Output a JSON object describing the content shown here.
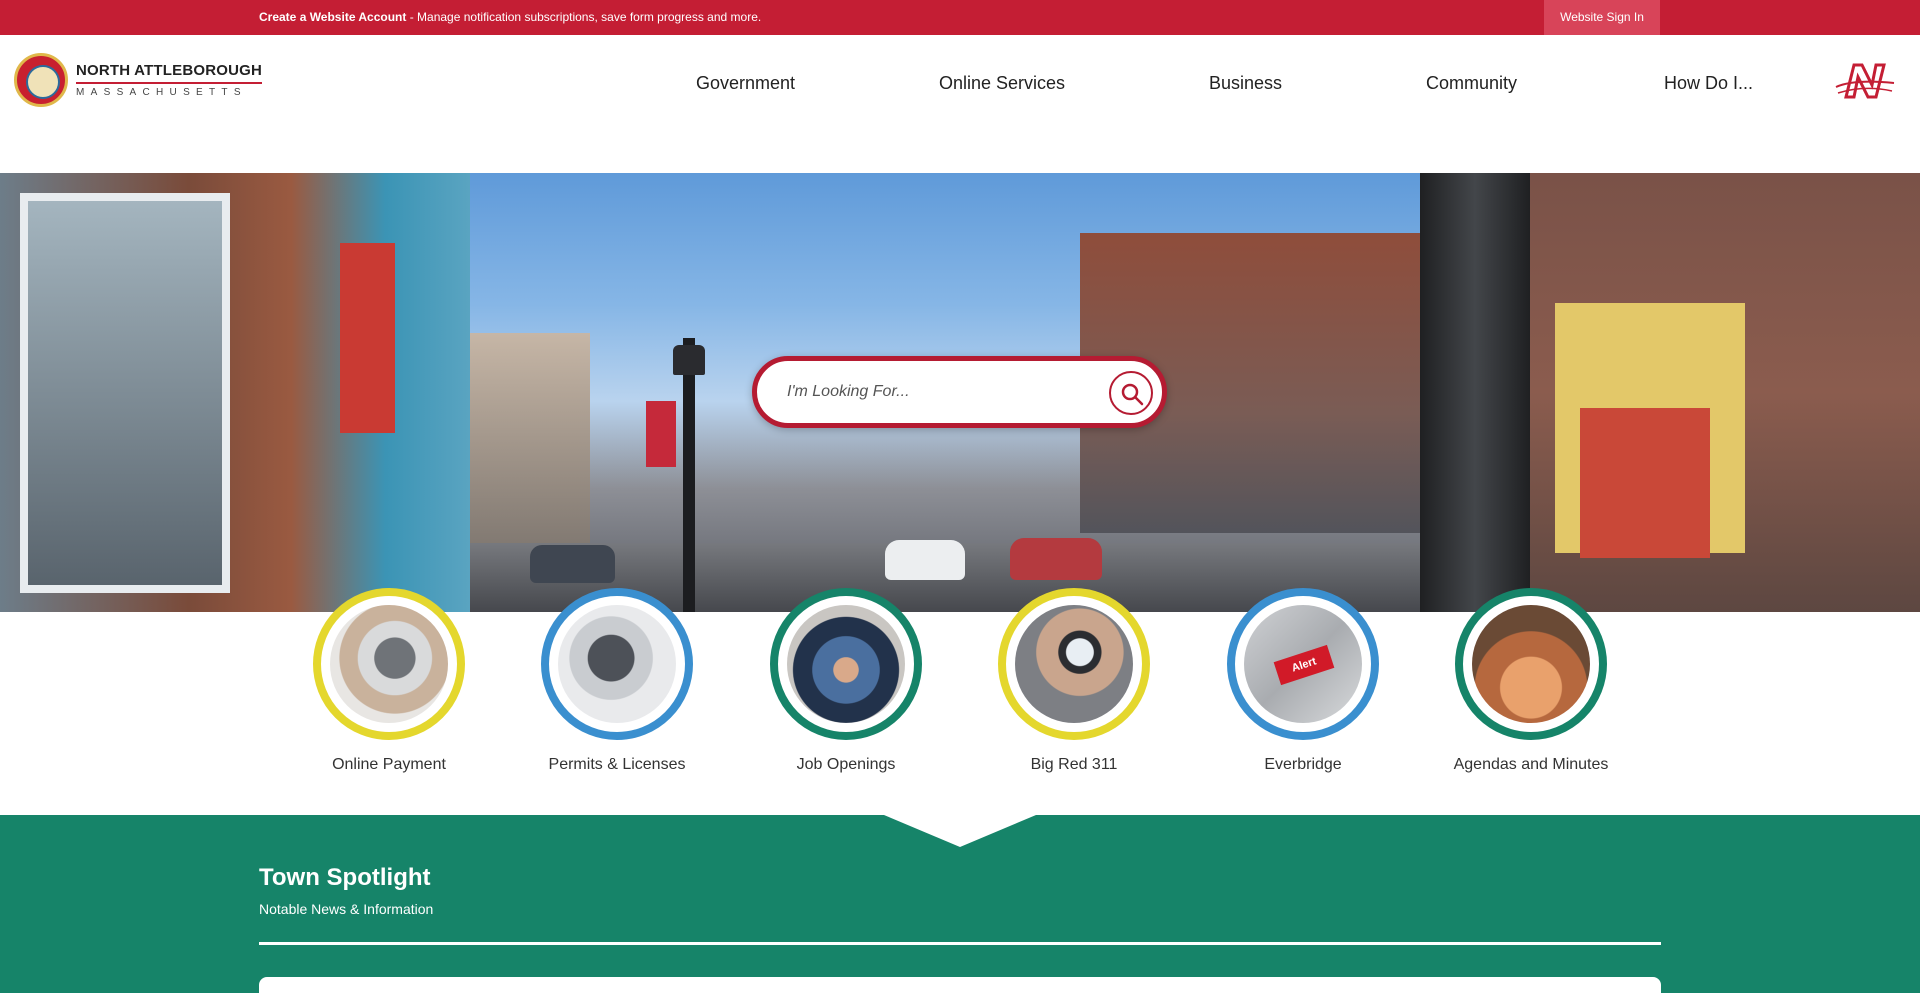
{
  "topbar": {
    "create_account": "Create a Website Account",
    "message": " - Manage notification subscriptions, save form progress and more.",
    "signin_label": "Website Sign In",
    "color": "#c41e34"
  },
  "header": {
    "logo_name": "NORTH ATTLEBOROUGH",
    "logo_state": "MASSACHUSETTS"
  },
  "nav": {
    "items": [
      "Government",
      "Online Services",
      "Business",
      "Community",
      "How Do I..."
    ]
  },
  "search": {
    "placeholder": "I'm Looking For...",
    "icon": "search-icon"
  },
  "quick_links": [
    {
      "label": "Online Payment",
      "ring": "#e4d72d"
    },
    {
      "label": "Permits & Licenses",
      "ring": "#3a8fcf"
    },
    {
      "label": "Job Openings",
      "ring": "#168469"
    },
    {
      "label": "Big Red 311",
      "ring": "#e4d72d"
    },
    {
      "label": "Everbridge",
      "ring": "#3a8fcf"
    },
    {
      "label": "Agendas and Minutes",
      "ring": "#168469"
    }
  ],
  "alert_key_text": "Alert",
  "spotlight": {
    "title": "Town Spotlight",
    "subtitle": "Notable News & Information",
    "color": "#168469"
  }
}
